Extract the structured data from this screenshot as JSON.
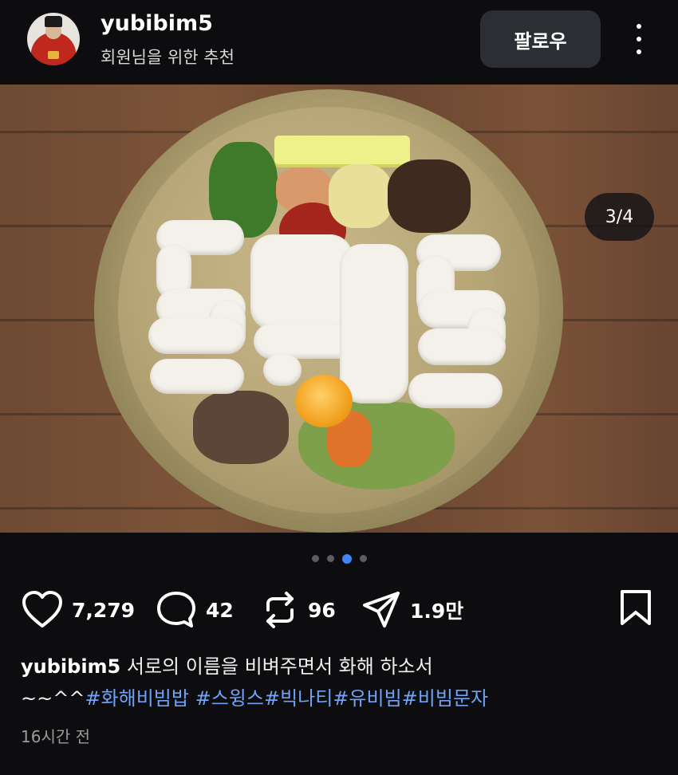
{
  "header": {
    "username": "yubibim5",
    "subtitle": "회원님을 위한 추천",
    "follow_label": "팔로우"
  },
  "post": {
    "page_indicator": "3/4",
    "carousel": {
      "total": 4,
      "active_index": 3
    },
    "stats": {
      "likes": "7,279",
      "comments": "42",
      "reposts": "96",
      "shares": "1.9만"
    },
    "caption": {
      "author": "yubibim5",
      "text": "서로의 이름을 비벼주면서 화해 하소서",
      "prefix": "~~^^",
      "hashtags": [
        "#화해비빔밥",
        "#스윙스",
        "#빅나티",
        "#유비빔",
        "#비빔문자"
      ]
    },
    "timestamp": "16시간 전"
  },
  "icons": {
    "heart": "heart-icon",
    "comment": "comment-icon",
    "repost": "repost-icon",
    "share": "share-icon",
    "bookmark": "bookmark-icon",
    "more": "more-vertical-icon"
  },
  "colors": {
    "background": "#0d0d0f",
    "hashtag": "#6ea3f7",
    "active_dot": "#3f86f5",
    "follow_button": "#2b2e33"
  }
}
